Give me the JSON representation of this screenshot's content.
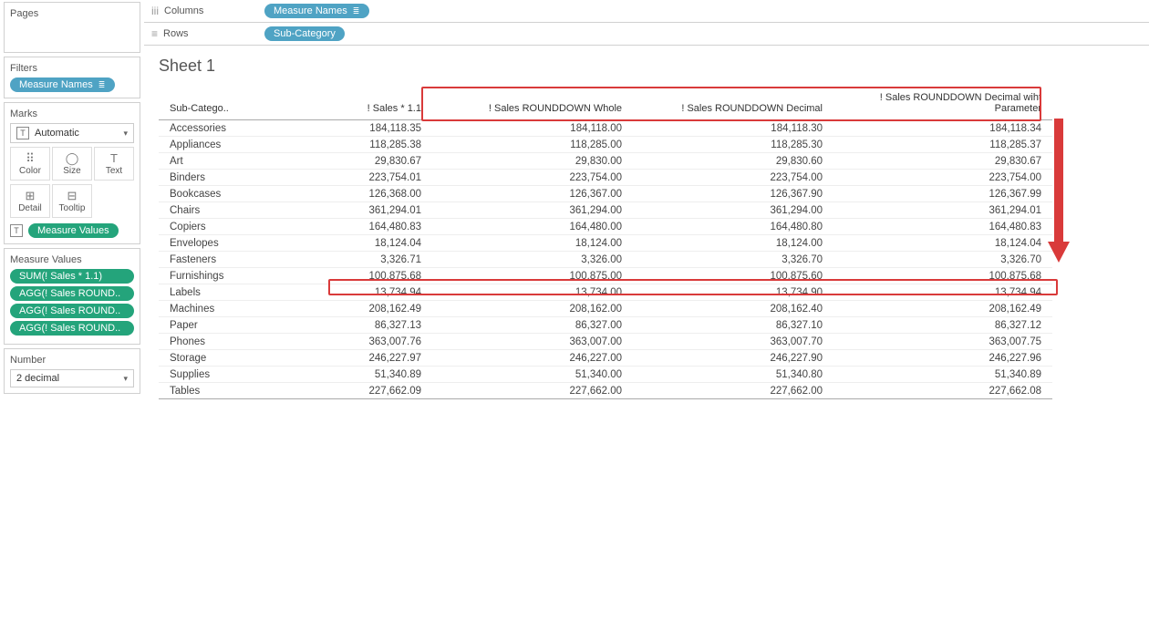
{
  "sidebar": {
    "pages_label": "Pages",
    "filters_label": "Filters",
    "filters_pill": "Measure Names",
    "marks_label": "Marks",
    "marks_type": "Automatic",
    "marks_cells": {
      "color": "Color",
      "size": "Size",
      "text": "Text",
      "detail": "Detail",
      "tooltip": "Tooltip"
    },
    "marks_mv_pill": "Measure Values",
    "mv_label": "Measure Values",
    "mv_items": [
      "SUM(! Sales * 1.1)",
      "AGG(! Sales ROUND..",
      "AGG(! Sales ROUND..",
      "AGG(! Sales ROUND.."
    ],
    "param_label": "Number",
    "param_value": "2 decimal"
  },
  "shelves": {
    "columns_label": "Columns",
    "columns_pill": "Measure Names",
    "rows_label": "Rows",
    "rows_pill": "Sub-Category"
  },
  "sheet": {
    "title": "Sheet 1",
    "columns": [
      "Sub-Catego..",
      "! Sales * 1.1",
      "! Sales ROUNDDOWN Whole",
      "! Sales ROUNDDOWN Decimal",
      "! Sales ROUNDDOWN Decimal wiht Parameter"
    ],
    "rows": [
      {
        "cat": "Accessories",
        "v": [
          "184,118.35",
          "184,118.00",
          "184,118.30",
          "184,118.34"
        ]
      },
      {
        "cat": "Appliances",
        "v": [
          "118,285.38",
          "118,285.00",
          "118,285.30",
          "118,285.37"
        ]
      },
      {
        "cat": "Art",
        "v": [
          "29,830.67",
          "29,830.00",
          "29,830.60",
          "29,830.67"
        ]
      },
      {
        "cat": "Binders",
        "v": [
          "223,754.01",
          "223,754.00",
          "223,754.00",
          "223,754.00"
        ]
      },
      {
        "cat": "Bookcases",
        "v": [
          "126,368.00",
          "126,367.00",
          "126,367.90",
          "126,367.99"
        ]
      },
      {
        "cat": "Chairs",
        "v": [
          "361,294.01",
          "361,294.00",
          "361,294.00",
          "361,294.01"
        ]
      },
      {
        "cat": "Copiers",
        "v": [
          "164,480.83",
          "164,480.00",
          "164,480.80",
          "164,480.83"
        ]
      },
      {
        "cat": "Envelopes",
        "v": [
          "18,124.04",
          "18,124.00",
          "18,124.00",
          "18,124.04"
        ]
      },
      {
        "cat": "Fasteners",
        "v": [
          "3,326.71",
          "3,326.00",
          "3,326.70",
          "3,326.70"
        ]
      },
      {
        "cat": "Furnishings",
        "v": [
          "100,875.68",
          "100,875.00",
          "100,875.60",
          "100,875.68"
        ]
      },
      {
        "cat": "Labels",
        "v": [
          "13,734.94",
          "13,734.00",
          "13,734.90",
          "13,734.94"
        ]
      },
      {
        "cat": "Machines",
        "v": [
          "208,162.49",
          "208,162.00",
          "208,162.40",
          "208,162.49"
        ]
      },
      {
        "cat": "Paper",
        "v": [
          "86,327.13",
          "86,327.00",
          "86,327.10",
          "86,327.12"
        ]
      },
      {
        "cat": "Phones",
        "v": [
          "363,007.76",
          "363,007.00",
          "363,007.70",
          "363,007.75"
        ]
      },
      {
        "cat": "Storage",
        "v": [
          "246,227.97",
          "246,227.00",
          "246,227.90",
          "246,227.96"
        ]
      },
      {
        "cat": "Supplies",
        "v": [
          "51,340.89",
          "51,340.00",
          "51,340.80",
          "51,340.89"
        ]
      },
      {
        "cat": "Tables",
        "v": [
          "227,662.09",
          "227,662.00",
          "227,662.00",
          "227,662.08"
        ]
      }
    ]
  },
  "icons": {
    "caret_down": "▾",
    "sort_bars": "≡"
  }
}
